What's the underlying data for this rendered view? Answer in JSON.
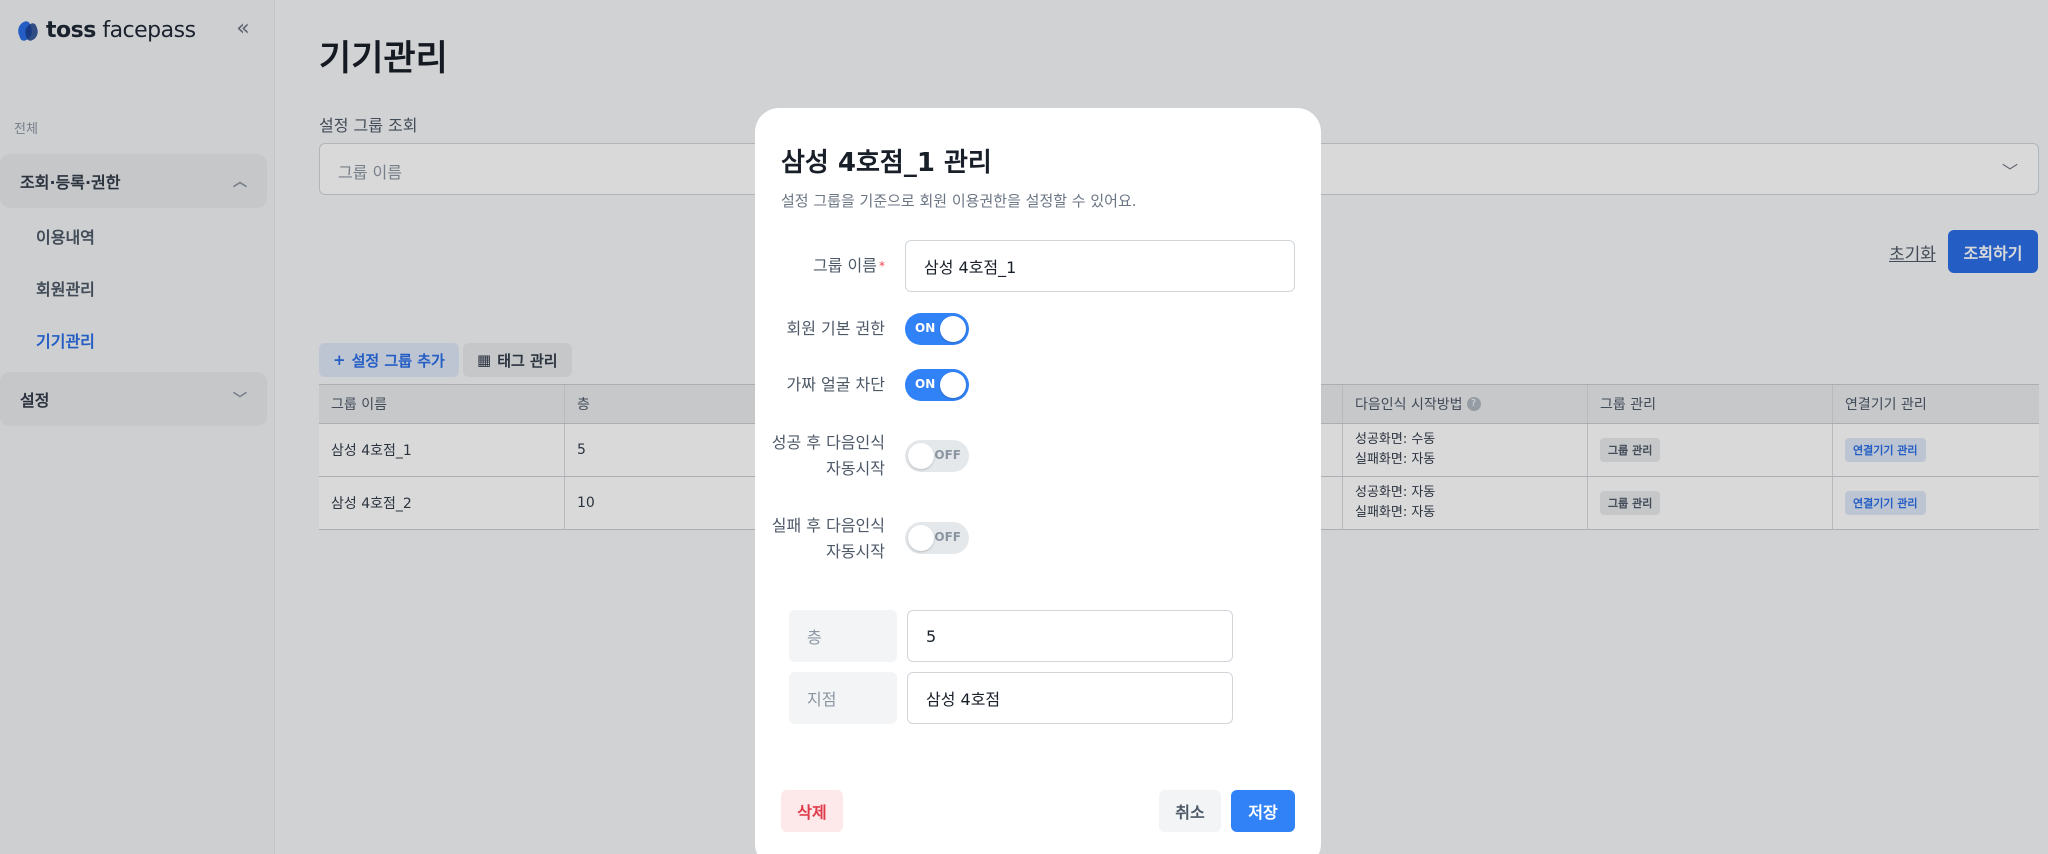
{
  "brand": {
    "logo_bold": "toss",
    "logo_light": " facepass"
  },
  "sidebar": {
    "section": "전체",
    "group1": "조회·등록·권한",
    "items": [
      "이용내역",
      "회원관리",
      "기기관리"
    ],
    "group2": "설정"
  },
  "main": {
    "title": "기기관리",
    "filter_label": "설정 그룹 조회",
    "filter_placeholder": "그룹 이름",
    "reset": "초기화",
    "search": "조회하기",
    "add_group": "설정 그룹 추가",
    "tag_manage": "태그 관리",
    "table": {
      "headers": [
        "그룹 이름",
        "층",
        "다음인식 시작방법",
        "그룹 관리",
        "연결기기 관리"
      ],
      "rows": [
        {
          "name": "삼성 4호점_1",
          "floor": "5",
          "start1": "성공화면: 수동",
          "start2": "실패화면: 자동",
          "group_btn": "그룹 관리",
          "device_btn": "연결기기 관리"
        },
        {
          "name": "삼성 4호점_2",
          "floor": "10",
          "start1": "성공화면: 자동",
          "start2": "실패화면: 자동",
          "group_btn": "그룹 관리",
          "device_btn": "연결기기 관리"
        }
      ]
    }
  },
  "modal": {
    "title": "삼성 4호점_1 관리",
    "description": "설정 그룹을 기준으로 회원 이용권한을 설정할 수 있어요.",
    "group_name_label": "그룹 이름",
    "group_name_value": "삼성 4호점_1",
    "toggles": [
      {
        "label": "회원 기본 권한",
        "state": "ON"
      },
      {
        "label": "가짜 얼굴 차단",
        "state": "ON"
      },
      {
        "label1": "성공 후 다음인식",
        "label2": "자동시작",
        "state": "OFF"
      },
      {
        "label1": "실패 후 다음인식",
        "label2": "자동시작",
        "state": "OFF"
      }
    ],
    "fields": [
      {
        "key": "층",
        "value": "5"
      },
      {
        "key": "지점",
        "value": "삼성 4호점"
      }
    ],
    "delete": "삭제",
    "cancel": "취소",
    "save": "저장"
  }
}
